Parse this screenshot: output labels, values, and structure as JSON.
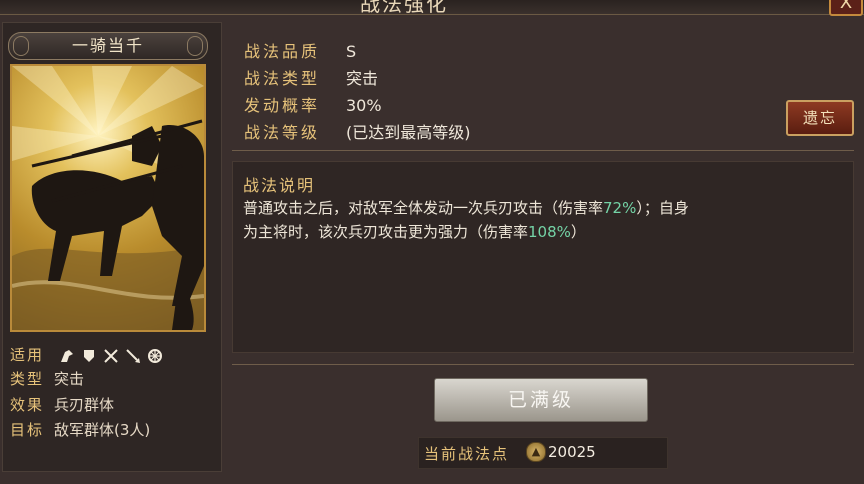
{
  "header": {
    "title": "战法强化",
    "close_label": "X"
  },
  "tactic": {
    "name": "一骑当千",
    "info": [
      {
        "key": "适用",
        "icons": [
          "cavalry-icon",
          "shield-icon",
          "bow-icon",
          "spear-icon",
          "wheel-icon"
        ]
      },
      {
        "key": "类型",
        "value": "突击"
      },
      {
        "key": "效果",
        "value": "兵刃群体"
      },
      {
        "key": "目标",
        "value": "敌军群体(3人)"
      }
    ]
  },
  "stats": [
    {
      "label": "战法品质",
      "value": "S"
    },
    {
      "label": "战法类型",
      "value": "突击"
    },
    {
      "label": "发动概率",
      "value": "30%"
    },
    {
      "label": "战法等级",
      "value": "(已达到最高等级)"
    }
  ],
  "forget_button": "遗忘",
  "description": {
    "title": "战法说明",
    "line1_pre": "普通攻击之后，对敌军全体发动一次兵刃攻击（伤害率",
    "line1_pct": "72%",
    "line1_post": "）；自身",
    "line2_pre": "为主将时，该次兵刃攻击更为强力（伤害率",
    "line2_pct": "108%",
    "line2_post": "）"
  },
  "level_button": "已满级",
  "points": {
    "label": "当前战法点",
    "value": "20025"
  },
  "colors": {
    "label_gold": "#e6c27a",
    "percent_green": "#74d3a6",
    "background": "#3a2f2d"
  }
}
